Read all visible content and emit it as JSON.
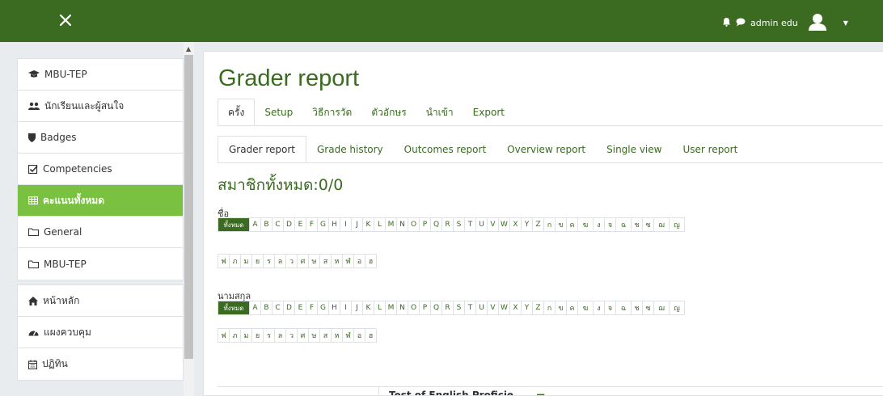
{
  "topbar": {
    "user_name": "admin edu"
  },
  "sidebar": {
    "group1": [
      {
        "label": "MBU-TEP",
        "icon": "graduation-cap-icon"
      },
      {
        "label": "นักเรียนและผู้สนใจ",
        "icon": "users-icon"
      },
      {
        "label": "Badges",
        "icon": "shield-icon"
      },
      {
        "label": "Competencies",
        "icon": "checkbox-icon"
      },
      {
        "label": "คะแนนทั้งหมด",
        "icon": "table-icon",
        "active": true
      },
      {
        "label": "General",
        "icon": "folder-icon"
      },
      {
        "label": "MBU-TEP",
        "icon": "folder-icon"
      }
    ],
    "group2": [
      {
        "label": "หน้าหลัก",
        "icon": "home-icon"
      },
      {
        "label": "แผงควบคุม",
        "icon": "dashboard-icon"
      },
      {
        "label": "ปฏิทิน",
        "icon": "calendar-icon"
      }
    ]
  },
  "main": {
    "title": "Grader report",
    "tabs1": [
      "ครั้ง",
      "Setup",
      "วิธีการวัด",
      "ตัวอักษร",
      "นำเข้า",
      "Export"
    ],
    "tabs2": [
      "Grader report",
      "Grade history",
      "Outcomes report",
      "Overview report",
      "Single view",
      "User report"
    ],
    "members": "สมาชิกทั้งหมด:0/0",
    "firstname_label": "ชื่อ",
    "lastname_label": "นามสกุล",
    "all_label": "ทั้งหมด",
    "letters_row1": [
      "A",
      "B",
      "C",
      "D",
      "E",
      "F",
      "G",
      "H",
      "I",
      "J",
      "K",
      "L",
      "M",
      "N",
      "O",
      "P",
      "Q",
      "R",
      "S",
      "T",
      "U",
      "V",
      "W",
      "X",
      "Y",
      "Z",
      "ก",
      "ข",
      "ค",
      "ฆ",
      "ง",
      "จ",
      "ฉ",
      "ช",
      "ซ",
      "ฌ",
      "ญ"
    ],
    "letters_row2": [
      "ฟ",
      "ภ",
      "ม",
      "ย",
      "ร",
      "ล",
      "ว",
      "ศ",
      "ษ",
      "ส",
      "ห",
      "ฬ",
      "อ",
      "ฮ"
    ],
    "column_title": "Test of English Proficie..."
  },
  "colors": {
    "topbar": "#3a6b21",
    "accent": "#3a6b21",
    "active_nav": "#7ac142"
  }
}
